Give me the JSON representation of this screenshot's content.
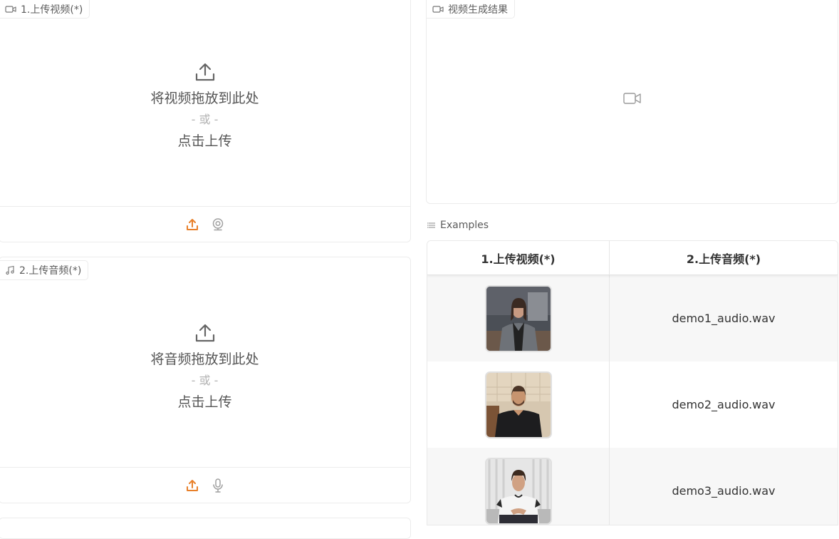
{
  "video_input": {
    "label": "1.上传视频(*)",
    "drop_text": "将视频拖放到此处",
    "or_text": "- 或 -",
    "click_text": "点击上传"
  },
  "audio_input": {
    "label": "2.上传音频(*)",
    "drop_text": "将音频拖放到此处",
    "or_text": "- 或 -",
    "click_text": "点击上传"
  },
  "output": {
    "label": "视频生成结果"
  },
  "examples": {
    "label": "Examples",
    "headers": [
      "1.上传视频(*)",
      "2.上传音频(*)"
    ],
    "rows": [
      {
        "thumb": "woman-grey-coat",
        "audio": "demo1_audio.wav"
      },
      {
        "thumb": "man-black-sweater",
        "audio": "demo2_audio.wav"
      },
      {
        "thumb": "man-white-tshirt",
        "audio": "demo3_audio.wav"
      }
    ]
  },
  "colors": {
    "accent": "#e8802a",
    "border": "#ececec",
    "muted_icon": "#9e9e9e"
  },
  "icons": [
    "video-icon",
    "music-icon",
    "upload-icon",
    "webcam-icon",
    "microphone-icon",
    "list-icon"
  ]
}
